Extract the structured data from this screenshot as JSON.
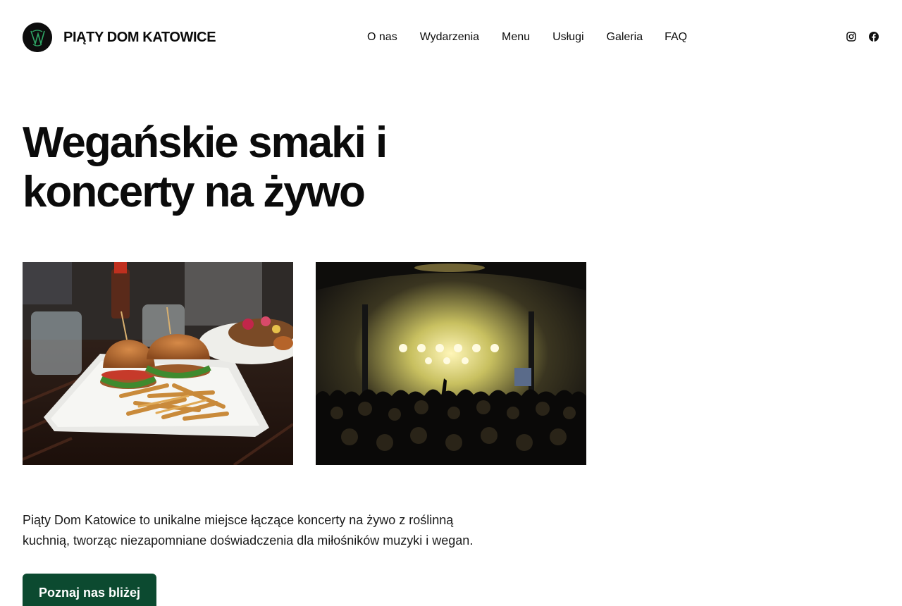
{
  "header": {
    "brand": "PIĄTY DOM KATOWICE",
    "nav": [
      {
        "label": "O nas",
        "name": "nav-o-nas"
      },
      {
        "label": "Wydarzenia",
        "name": "nav-wydarzenia"
      },
      {
        "label": "Menu",
        "name": "nav-menu"
      },
      {
        "label": "Usługi",
        "name": "nav-uslugi"
      },
      {
        "label": "Galeria",
        "name": "nav-galeria"
      },
      {
        "label": "FAQ",
        "name": "nav-faq"
      }
    ],
    "social": [
      "instagram-icon",
      "facebook-icon"
    ]
  },
  "hero": {
    "title_line1": "Wegańskie smaki i",
    "title_line2": "koncerty na żywo"
  },
  "images": [
    {
      "name": "photo-vegan-burgers",
      "subject": "vegan burgers with fries"
    },
    {
      "name": "photo-live-concert",
      "subject": "live concert crowd"
    }
  ],
  "description": "Piąty Dom Katowice to unikalne miejsce łączące koncerty na żywo z roślinną kuchnią, tworząc niezapomniane doświadczenia dla miłośników muzyki i wegan.",
  "cta": {
    "label": "Poznaj nas bliżej"
  },
  "colors": {
    "accent": "#0c4a30",
    "text": "#0b0b0b",
    "background": "#ffffff"
  }
}
